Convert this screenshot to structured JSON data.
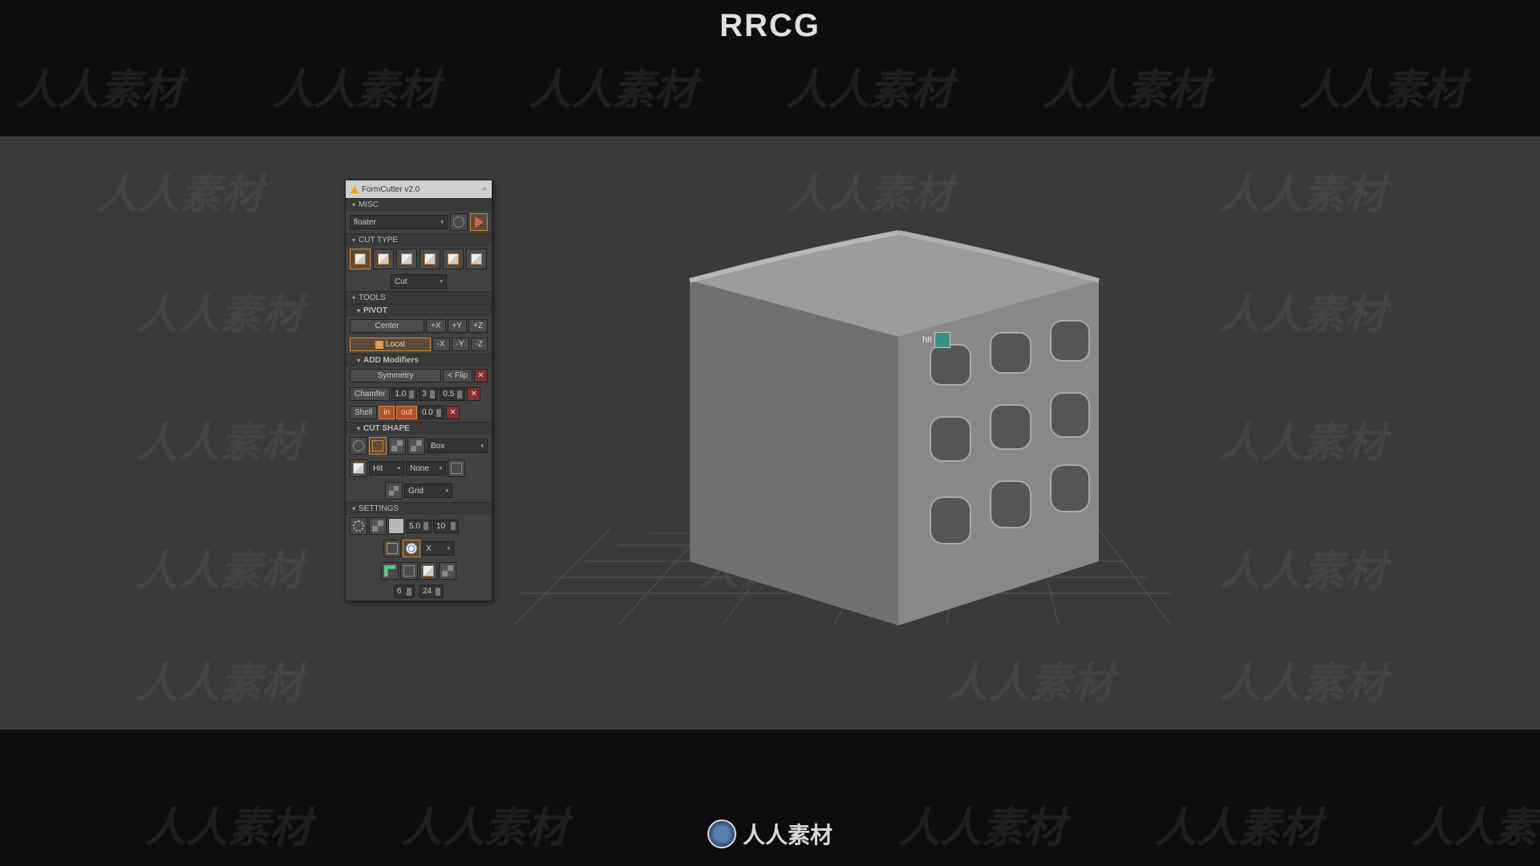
{
  "brand": {
    "top": "RRCG",
    "bottom": "人人素材"
  },
  "watermark": "人人素材",
  "panel_title": "FormCutter v2.0",
  "sections": {
    "misc": "MISC",
    "cuttype": "CUT TYPE",
    "tools": "TOOLS",
    "pivot": "PIVOT",
    "addmod": "ADD Modifiers",
    "cutshape": "CUT SHAPE",
    "settings": "SETTINGS"
  },
  "misc": {
    "mode": "floater"
  },
  "cuttype": {
    "mode": "Cut"
  },
  "pivot": {
    "center": "Center",
    "local": "Local",
    "px": "+X",
    "py": "+Y",
    "pz": "+Z",
    "nx": "-X",
    "ny": "-Y",
    "nz": "-Z"
  },
  "addmod": {
    "sym": "Symmetry",
    "flip": "< Flip",
    "chamfer": "Chamfer",
    "ch_v1": "1.0",
    "ch_v2": "3",
    "ch_v3": "0.5",
    "shell": "Shell",
    "in": "in",
    "out": "out",
    "sh_v": "0.0"
  },
  "cutshape": {
    "shape": "Box",
    "hit": "Hit",
    "none": "None",
    "grid": "Grid"
  },
  "settings": {
    "s1": "5.0",
    "s2": "10",
    "ax": "X",
    "a": "6",
    "b": "24"
  },
  "cursor_hint": "hit"
}
